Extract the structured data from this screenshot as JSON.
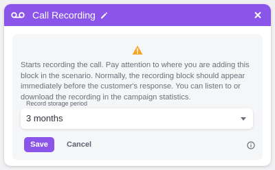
{
  "header": {
    "title": "Call Recording",
    "icon": "voicemail-icon",
    "edit_icon": "pencil-icon",
    "close_icon": "close-icon",
    "background": "#8a55e8"
  },
  "body": {
    "warning_icon": "warning-icon",
    "description": "Starts recording the call. Pay attention to where you are adding this block in the scenario. Normally, the recording block should appear immediately before the customer's response. You can listen to or download the recording in the campaign statistics."
  },
  "storage_field": {
    "label": "Record storage period",
    "value": "3 months"
  },
  "actions": {
    "save_label": "Save",
    "cancel_label": "Cancel",
    "info_icon": "info-icon"
  }
}
